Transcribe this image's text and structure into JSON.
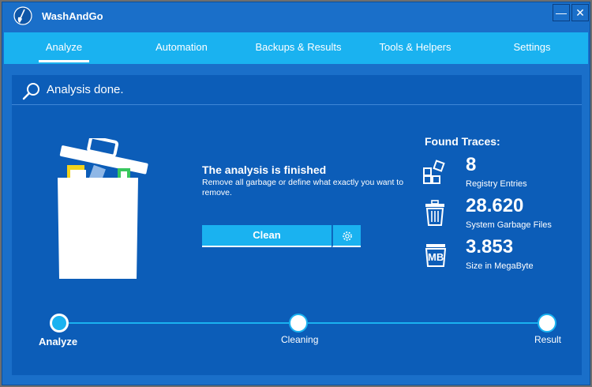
{
  "window": {
    "title": "WashAndGo",
    "minimize_glyph": "—",
    "close_glyph": "✕"
  },
  "tabs": [
    {
      "label": "Analyze",
      "active": true
    },
    {
      "label": "Automation",
      "active": false
    },
    {
      "label": "Backups & Results",
      "active": false
    },
    {
      "label": "Tools & Helpers",
      "active": false
    },
    {
      "label": "Settings",
      "active": false
    }
  ],
  "status": {
    "text": "Analysis done.",
    "icon": "search-icon"
  },
  "result": {
    "headline": "The analysis is finished",
    "description": "Remove all garbage or define what exactly you want to remove.",
    "clean_label": "Clean",
    "settings_icon": "gear-icon"
  },
  "traces": {
    "title": "Found Traces:",
    "items": [
      {
        "value": "8",
        "label": "Registry Entries",
        "icon": "registry-icon"
      },
      {
        "value": "28.620",
        "label": "System Garbage Files",
        "icon": "trash-icon"
      },
      {
        "value": "3.853",
        "label": "Size in MegaByte",
        "icon": "megabyte-icon",
        "icon_text": "MB"
      }
    ]
  },
  "steps": [
    {
      "label": "Analyze",
      "active": true
    },
    {
      "label": "Cleaning",
      "active": false
    },
    {
      "label": "Result",
      "active": false
    }
  ],
  "colors": {
    "window_bg": "#1a6fc9",
    "content_bg": "#0c5db8",
    "accent": "#1ab2f0",
    "text": "#ffffff"
  }
}
